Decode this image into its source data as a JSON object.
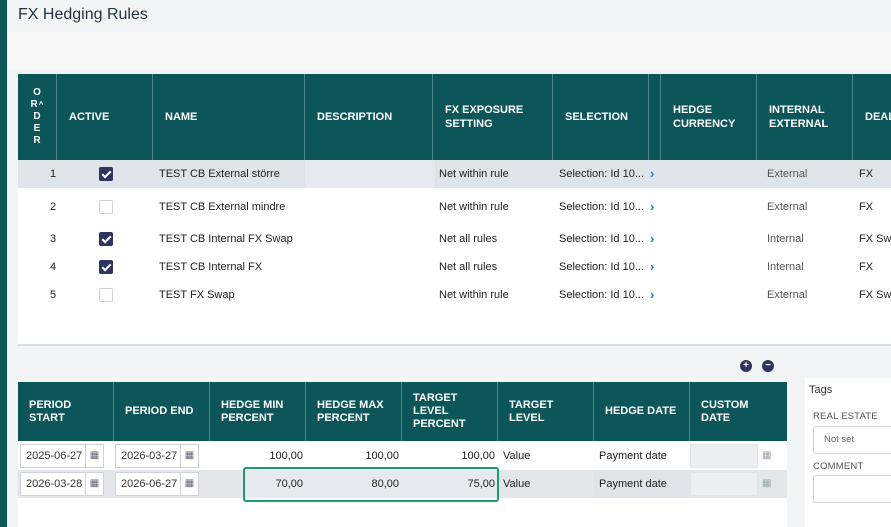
{
  "page": {
    "title": "FX Hedging Rules"
  },
  "rules_table": {
    "headers": {
      "order_letters": [
        "O",
        "R",
        "D",
        "E",
        "R"
      ],
      "active": "ACTIVE",
      "name": "NAME",
      "description": "DESCRIPTION",
      "fx_exposure_line1": "FX EXPOSURE",
      "fx_exposure_line2": "SETTING",
      "selection": "SELECTION",
      "hedge_currency_line1": "HEDGE",
      "hedge_currency_line2": "CURRENCY",
      "internal_external_line1": "INTERNAL",
      "internal_external_line2": "EXTERNAL",
      "deal": "DEAL"
    },
    "rows": [
      {
        "order": "1",
        "active": true,
        "name": "TEST CB External större",
        "fx_exposure": "Net within rule",
        "selection": "Selection: Id 10...",
        "internal_external": "External",
        "deal": "FX"
      },
      {
        "order": "2",
        "active": false,
        "name": "TEST CB External mindre",
        "fx_exposure": "Net within rule",
        "selection": "Selection: Id 10...",
        "internal_external": "External",
        "deal": "FX"
      },
      {
        "order": "3",
        "active": true,
        "name": "TEST CB Internal FX Swap",
        "fx_exposure": "Net all rules",
        "selection": "Selection: Id 10...",
        "internal_external": "Internal",
        "deal": "FX Swa"
      },
      {
        "order": "4",
        "active": true,
        "name": "TEST CB Internal FX",
        "fx_exposure": "Net all rules",
        "selection": "Selection: Id 10...",
        "internal_external": "Internal",
        "deal": "FX"
      },
      {
        "order": "5",
        "active": false,
        "name": "TEST FX Swap",
        "fx_exposure": "Net within rule",
        "selection": "Selection: Id 10...",
        "internal_external": "External",
        "deal": "FX Swa"
      }
    ]
  },
  "period_table": {
    "headers": {
      "period_start_l1": "PERIOD",
      "period_start_l2": "START",
      "period_end": "PERIOD END",
      "hedge_min_l1": "HEDGE MIN",
      "hedge_min_l2": "PERCENT",
      "hedge_max_l1": "HEDGE MAX",
      "hedge_max_l2": "PERCENT",
      "target_level_pct_l1": "TARGET",
      "target_level_pct_l2": "LEVEL",
      "target_level_pct_l3": "PERCENT",
      "target_level_l1": "TARGET",
      "target_level_l2": "LEVEL",
      "hedge_date": "HEDGE DATE",
      "custom_date_l1": "CUSTOM",
      "custom_date_l2": "DATE"
    },
    "rows": [
      {
        "start": "2025-06-27",
        "end": "2026-03-27",
        "min": "100,00",
        "max": "100,00",
        "target_pct": "100,00",
        "target_level": "Value",
        "hedge_date": "Payment date"
      },
      {
        "start": "2026-03-28",
        "end": "2026-06-27",
        "min": "70,00",
        "max": "80,00",
        "target_pct": "75,00",
        "target_level": "Value",
        "hedge_date": "Payment date"
      }
    ]
  },
  "tags": {
    "title": "Tags",
    "real_estate_label": "REAL ESTATE",
    "real_estate_value": "Not set",
    "comment_label": "COMMENT"
  },
  "icons": {
    "plus": "plus-circle-icon",
    "minus": "minus-circle-icon",
    "calendar": "calendar-icon",
    "chevron": "chevron-right-icon",
    "sort": "sort-up-icon"
  },
  "colors": {
    "header": "#0c5559",
    "checkbox": "#2d3560",
    "highlight": "#1b9e6a",
    "link": "#1e7bd6"
  }
}
